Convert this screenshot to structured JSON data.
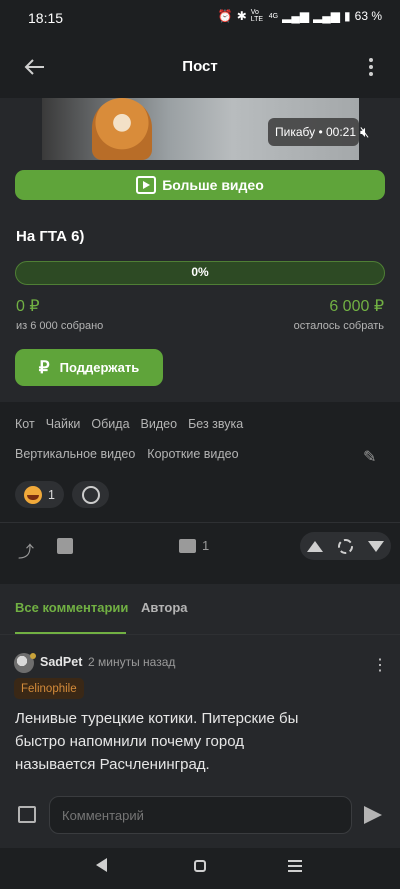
{
  "status": {
    "time": "18:15",
    "battery": "63 %",
    "icons": [
      "alarm-icon",
      "bluetooth-icon",
      "volte-icon",
      "signal-icon",
      "signal-icon",
      "battery-icon"
    ],
    "volte": "Vo LTE",
    "net": "4G"
  },
  "header": {
    "title": "Пост"
  },
  "video": {
    "badge": "Пикабу • 00:21",
    "more_button": "Больше видео"
  },
  "post": {
    "title": "На ГТА 6)",
    "progress": 0,
    "progress_label": "0%",
    "collected": "0 ₽",
    "collected_sub": "из 6 000 собрано",
    "remaining": "6 000 ₽",
    "remaining_sub": "осталось собрать",
    "support_button": "Поддержать",
    "tags_row1": [
      "Кот",
      "Чайки",
      "Обида",
      "Видео",
      "Без звука"
    ],
    "tags_row2": [
      "Вертикальное видео",
      "Короткие видео"
    ],
    "reaction_count": "1",
    "comment_count": "1"
  },
  "comments": {
    "tabs": [
      "Все комментарии",
      "Автора"
    ],
    "items": [
      {
        "user": "SadPet",
        "when": "2 минуты назад",
        "badge": "Felinophile",
        "text": "Ленивые турецкие котики. Питерские бы быстро напомнили почему город называется Расчленинград."
      }
    ],
    "input_placeholder": "Комментарий"
  },
  "colors": {
    "accent": "#5fa43a",
    "accent_text": "#71b043",
    "background": "#1d1f21",
    "card": "#26282b"
  }
}
